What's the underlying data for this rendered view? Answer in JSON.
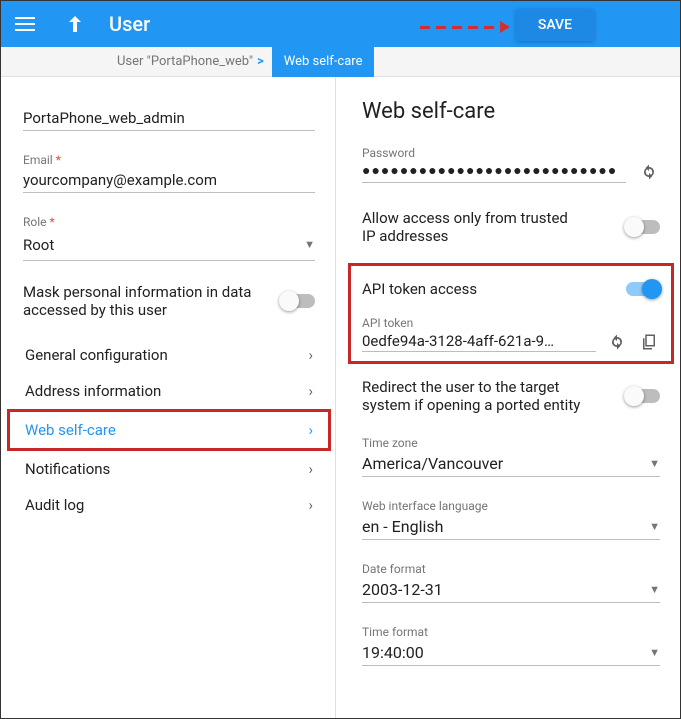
{
  "header": {
    "title": "User",
    "save_label": "SAVE"
  },
  "breadcrumb": {
    "parent": "User \"PortaPhone_web\"",
    "current": "Web self-care"
  },
  "left": {
    "name_value": "PortaPhone_web_admin",
    "email_label": "Email",
    "email_value": "yourcompany@example.com",
    "role_label": "Role",
    "role_value": "Root",
    "mask_label": "Mask personal information in data accessed by this user",
    "nav": {
      "general": "General configuration",
      "address": "Address information",
      "webself": "Web self-care",
      "notif": "Notifications",
      "audit": "Audit log"
    }
  },
  "right": {
    "title": "Web self-care",
    "password_label": "Password",
    "password_value": "●●●●●●●●●●●●●●●●●●●●●●●●●●●",
    "trusted_label": "Allow access only from trusted IP addresses",
    "api_access_label": "API token access",
    "api_token_label": "API token",
    "api_token_value": "0edfe94a-3128-4aff-621a-9…",
    "redirect_label": "Redirect the user to the target system if opening a ported entity",
    "tz_label": "Time zone",
    "tz_value": "America/Vancouver",
    "lang_label": "Web interface language",
    "lang_value": "en - English",
    "date_label": "Date format",
    "date_value": "2003-12-31",
    "time_label": "Time format",
    "time_value": "19:40:00"
  }
}
